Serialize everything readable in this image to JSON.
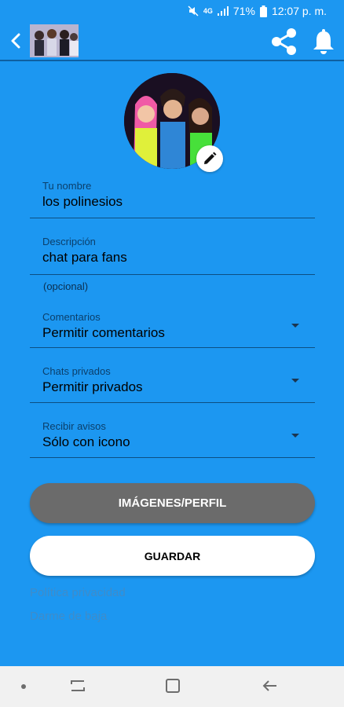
{
  "status_bar": {
    "network": "4G",
    "battery": "71%",
    "time": "12:07 p. m."
  },
  "app_bar": {
    "back_icon": "chevron-left-icon",
    "share_icon": "share-icon",
    "bell_icon": "bell-icon"
  },
  "form": {
    "name_label": "Tu nombre",
    "name_value": "los polinesios",
    "description_label": "Descripción",
    "description_value": "chat para fans",
    "description_helper": "(opcional)",
    "comments_label": "Comentarios",
    "comments_value": "Permitir comentarios",
    "private_label": "Chats privados",
    "private_value": "Permitir privados",
    "notify_label": "Recibir avisos",
    "notify_value": "Sólo con icono"
  },
  "buttons": {
    "images_label": "IMÁGENES/PERFIL",
    "save_label": "GUARDAR"
  },
  "links": {
    "privacy": "Política privacidad",
    "unsubscribe": "Darme de baja"
  },
  "colors": {
    "background": "#1c97f1",
    "images_button": "#6b6b6b",
    "save_button": "#ffffff",
    "link": "#3f8cc9"
  }
}
